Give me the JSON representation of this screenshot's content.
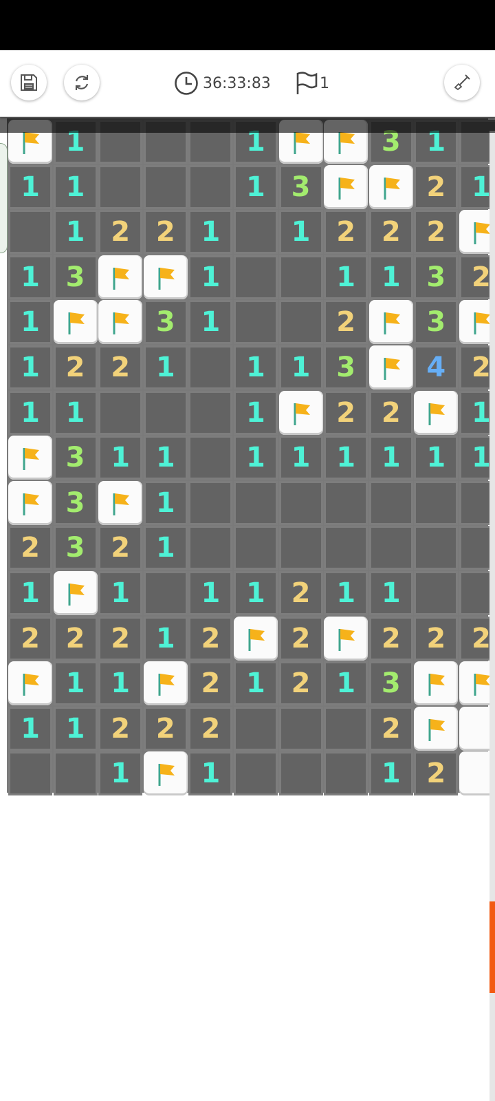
{
  "toolbar": {
    "save_icon": "save-icon",
    "refresh_icon": "refresh-icon",
    "clock_icon": "clock-icon",
    "timer": "36:33:83",
    "flag_icon": "flag-icon",
    "flag_count": "1",
    "shovel_icon": "shovel-icon"
  },
  "colors": {
    "n1": "#4ef2d6",
    "n2": "#f2d27a",
    "n3": "#a3ec6e",
    "n4": "#66aef5",
    "flag": "#f6b21a",
    "scroll_thumb": "#f25a12"
  },
  "board": {
    "rows": [
      [
        "F",
        "1",
        "",
        "",
        "",
        "1",
        "F",
        "F",
        "3",
        "1",
        ""
      ],
      [
        "1",
        "1",
        "",
        "",
        "",
        "1",
        "3",
        "F",
        "F",
        "2",
        "1"
      ],
      [
        "",
        "1",
        "2",
        "2",
        "1",
        "",
        "1",
        "2",
        "2",
        "2",
        "F"
      ],
      [
        "1",
        "3",
        "F",
        "F",
        "1",
        "",
        "",
        "1",
        "1",
        "3",
        "2"
      ],
      [
        "1",
        "F",
        "F",
        "3",
        "1",
        "",
        "",
        "2",
        "F",
        "3",
        "F"
      ],
      [
        "1",
        "2",
        "2",
        "1",
        "",
        "1",
        "1",
        "3",
        "F",
        "4",
        "2"
      ],
      [
        "1",
        "1",
        "",
        "",
        "",
        "1",
        "F",
        "2",
        "2",
        "F",
        "1"
      ],
      [
        "F",
        "3",
        "1",
        "1",
        "",
        "1",
        "1",
        "1",
        "1",
        "1",
        "1"
      ],
      [
        "F",
        "3",
        "F",
        "1",
        "",
        "",
        "",
        "",
        "",
        "",
        ""
      ],
      [
        "2",
        "3",
        "2",
        "1",
        "",
        "",
        "",
        "",
        "",
        "",
        ""
      ],
      [
        "1",
        "F",
        "1",
        "",
        "1",
        "1",
        "2",
        "1",
        "1",
        "",
        ""
      ],
      [
        "2",
        "2",
        "2",
        "1",
        "2",
        "F",
        "2",
        "F",
        "2",
        "2",
        "2"
      ],
      [
        "F",
        "1",
        "1",
        "F",
        "2",
        "1",
        "2",
        "1",
        "3",
        "F",
        "F"
      ],
      [
        "1",
        "1",
        "2",
        "2",
        "2",
        "",
        "",
        "",
        "2",
        "F",
        "U"
      ],
      [
        "",
        "",
        "1",
        "F",
        "1",
        "",
        "",
        "",
        "1",
        "2",
        "U"
      ]
    ]
  }
}
